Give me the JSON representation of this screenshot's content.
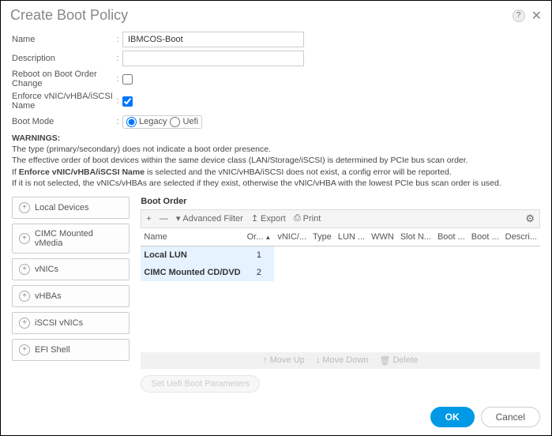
{
  "dialog": {
    "title": "Create Boot Policy",
    "help": "?",
    "close": "✕"
  },
  "form": {
    "name_label": "Name",
    "name_value": "IBMCOS-Boot",
    "desc_label": "Description",
    "desc_value": "",
    "reboot_label": "Reboot on Boot Order Change",
    "enforce_label": "Enforce vNIC/vHBA/iSCSI Name",
    "mode_label": "Boot Mode",
    "mode_legacy": "Legacy",
    "mode_uefi": "Uefi"
  },
  "warnings": {
    "head": "WARNINGS:",
    "l1": "The type (primary/secondary) does not indicate a boot order presence.",
    "l2": "The effective order of boot devices within the same device class (LAN/Storage/iSCSI) is determined by PCIe bus scan order.",
    "l3a": "If ",
    "l3b": "Enforce vNIC/vHBA/iSCSI Name",
    "l3c": " is selected and the vNIC/vHBA/iSCSI does not exist, a config error will be reported.",
    "l4": "If it is not selected, the vNICs/vHBAs are selected if they exist, otherwise the vNIC/vHBA with the lowest PCIe bus scan order is used."
  },
  "categories": [
    "Local Devices",
    "CIMC Mounted vMedia",
    "vNICs",
    "vHBAs",
    "iSCSI vNICs",
    "EFI Shell"
  ],
  "boot_order": {
    "title": "Boot Order",
    "toolbar": {
      "add": "+",
      "remove": "—",
      "filter": "Advanced Filter",
      "export": "Export",
      "print": "Print"
    },
    "columns": [
      "Name",
      "Or...",
      "vNIC/...",
      "Type",
      "LUN ...",
      "WWN",
      "Slot N...",
      "Boot ...",
      "Boot ...",
      "Descri..."
    ],
    "rows": [
      {
        "name": "Local LUN",
        "order": "1"
      },
      {
        "name": "CIMC Mounted CD/DVD",
        "order": "2"
      }
    ],
    "actions": {
      "up": "Move Up",
      "down": "Move Down",
      "del": "Delete"
    },
    "ghost": "Set Uefi Boot Parameters"
  },
  "footer": {
    "ok": "OK",
    "cancel": "Cancel"
  }
}
